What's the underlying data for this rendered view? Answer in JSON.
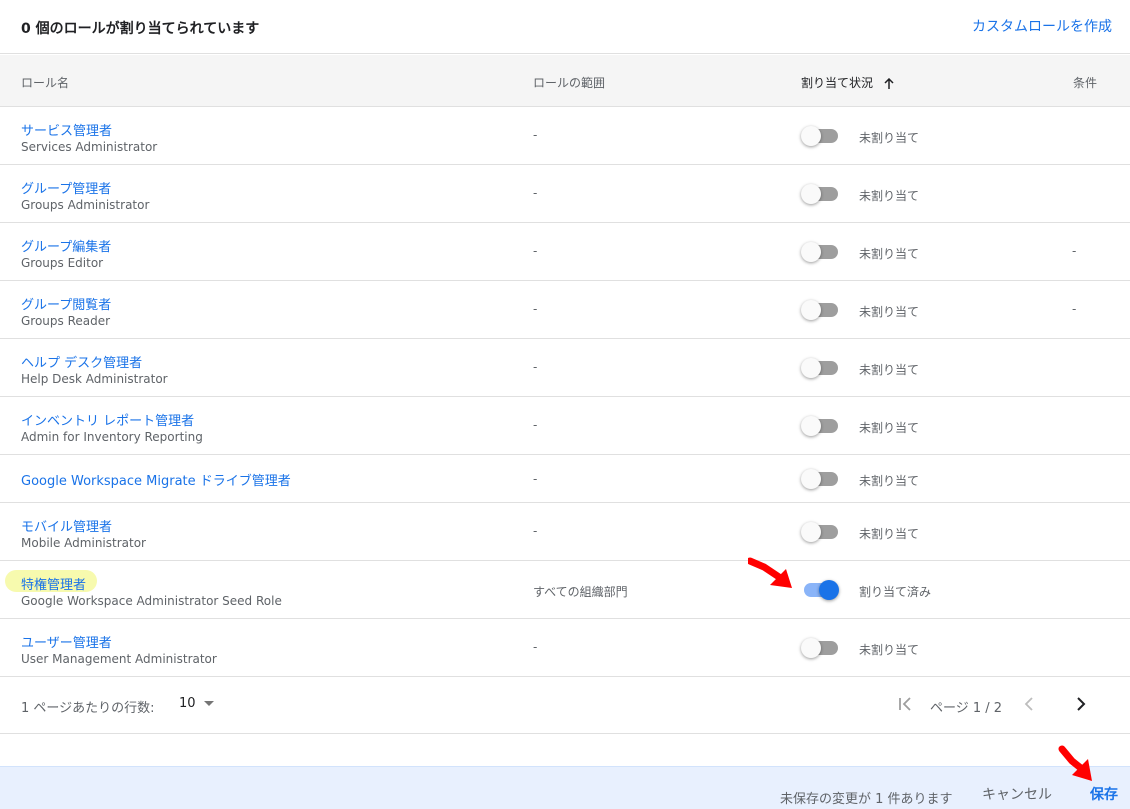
{
  "header": {
    "title": "0 個のロールが割り当てられています",
    "create_custom_role": "カスタムロールを作成"
  },
  "columns": {
    "role_name": "ロール名",
    "role_scope": "ロールの範囲",
    "assignment_status": "割り当て状況",
    "conditions": "条件"
  },
  "rows": [
    {
      "name": "サービス管理者",
      "sub": "Services Administrator",
      "scope": "-",
      "status": "未割り当て",
      "condition": "",
      "assigned": false
    },
    {
      "name": "グループ管理者",
      "sub": "Groups Administrator",
      "scope": "-",
      "status": "未割り当て",
      "condition": "",
      "assigned": false
    },
    {
      "name": "グループ編集者",
      "sub": "Groups Editor",
      "scope": "-",
      "status": "未割り当て",
      "condition": "-",
      "assigned": false
    },
    {
      "name": "グループ閲覧者",
      "sub": "Groups Reader",
      "scope": "-",
      "status": "未割り当て",
      "condition": "-",
      "assigned": false
    },
    {
      "name": "ヘルプ デスク管理者",
      "sub": "Help Desk Administrator",
      "scope": "-",
      "status": "未割り当て",
      "condition": "",
      "assigned": false
    },
    {
      "name": "インベントリ レポート管理者",
      "sub": "Admin for Inventory Reporting",
      "scope": "-",
      "status": "未割り当て",
      "condition": "",
      "assigned": false
    },
    {
      "name": "Google Workspace Migrate ドライブ管理者",
      "sub": "",
      "scope": "-",
      "status": "未割り当て",
      "condition": "",
      "assigned": false
    },
    {
      "name": "モバイル管理者",
      "sub": "Mobile Administrator",
      "scope": "-",
      "status": "未割り当て",
      "condition": "",
      "assigned": false
    },
    {
      "name": "特権管理者",
      "sub": "Google Workspace Administrator Seed Role",
      "scope": "すべての組織部門",
      "status": "割り当て済み",
      "condition": "",
      "assigned": true
    },
    {
      "name": "ユーザー管理者",
      "sub": "User Management Administrator",
      "scope": "-",
      "status": "未割り当て",
      "condition": "",
      "assigned": false
    }
  ],
  "pagination": {
    "rows_per_page_label": "1 ページあたりの行数:",
    "rows_per_page_value": "10",
    "page_info": "ページ 1 / 2"
  },
  "savebar": {
    "message": "未保存の変更が 1 件あります",
    "cancel": "キャンセル",
    "save": "保存"
  },
  "colors": {
    "accent": "#1a73e8",
    "toggle_on_track": "#8ab4f8",
    "toggle_off_track": "#9e9e9e",
    "annotation_arrow": "#ff0000",
    "highlight": "#f6f9a0"
  }
}
